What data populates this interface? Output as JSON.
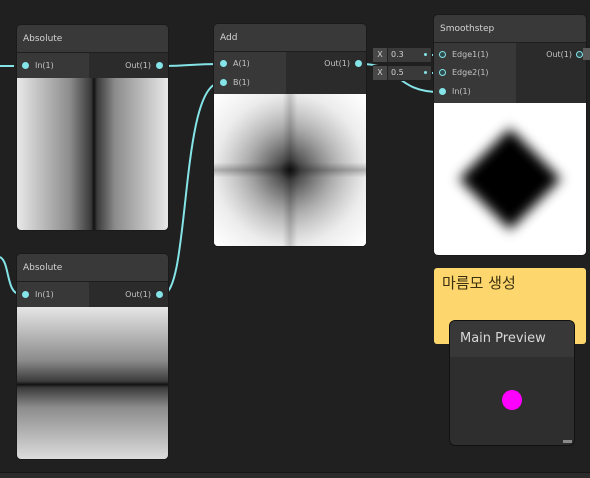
{
  "nodes": {
    "absolute_top": {
      "title": "Absolute",
      "input": "In(1)",
      "output": "Out(1)"
    },
    "absolute_bottom": {
      "title": "Absolute",
      "input": "In(1)",
      "output": "Out(1)"
    },
    "add": {
      "title": "Add",
      "input_a": "A(1)",
      "input_b": "B(1)",
      "output": "Out(1)"
    },
    "smoothstep": {
      "title": "Smoothstep",
      "input_edge1": "Edge1(1)",
      "input_edge2": "Edge2(1)",
      "input_in": "In(1)",
      "output": "Out(1)"
    }
  },
  "constants": {
    "edge1": {
      "axis": "X",
      "value": "0.3"
    },
    "edge2": {
      "axis": "X",
      "value": "0.5"
    }
  },
  "sticky_note": {
    "text": "마름모 생성",
    "color": "#fdd76e"
  },
  "main_preview": {
    "title": "Main Preview",
    "sphere_color": "#ff00ff"
  },
  "colors": {
    "wire": "#84e4e7",
    "canvas_bg": "#202020",
    "node_bg": "#2d2d2d"
  }
}
